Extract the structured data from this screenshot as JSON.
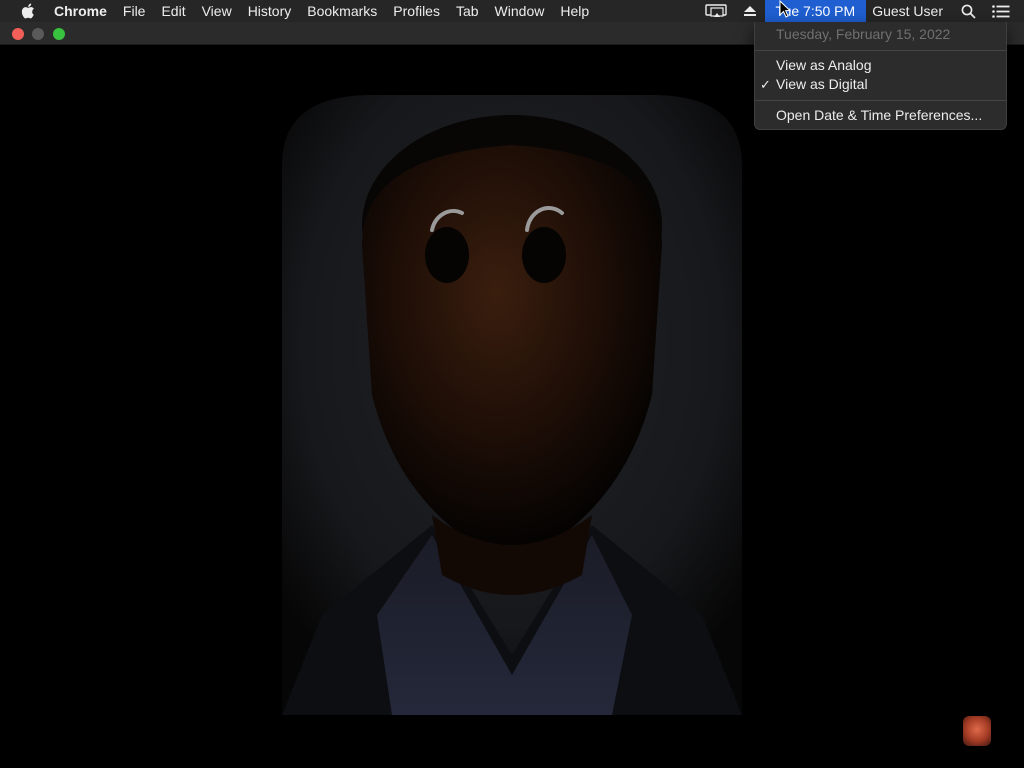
{
  "menubar": {
    "app_name": "Chrome",
    "menus": [
      "File",
      "Edit",
      "View",
      "History",
      "Bookmarks",
      "Profiles",
      "Tab",
      "Window",
      "Help"
    ],
    "clock": "Tue 7:50 PM",
    "user": "Guest User",
    "icons": [
      "apple-icon",
      "airplay-icon",
      "eject-icon",
      "search-icon",
      "notification-list-icon"
    ]
  },
  "window": {
    "traffic_lights": {
      "close": "#f25f58",
      "minimize": "#5a5a5a",
      "zoom": "#39c140"
    }
  },
  "clock_menu": {
    "date": "Tuesday, February 15, 2022",
    "items": [
      {
        "label": "View as Analog",
        "checked": false
      },
      {
        "label": "View as Digital",
        "checked": true
      }
    ],
    "preferences": "Open Date & Time Preferences...",
    "checkmark": "✓"
  },
  "colors": {
    "menubar_bg": "#262626",
    "highlight": "#1f5fd1",
    "content_bg": "#000000"
  }
}
